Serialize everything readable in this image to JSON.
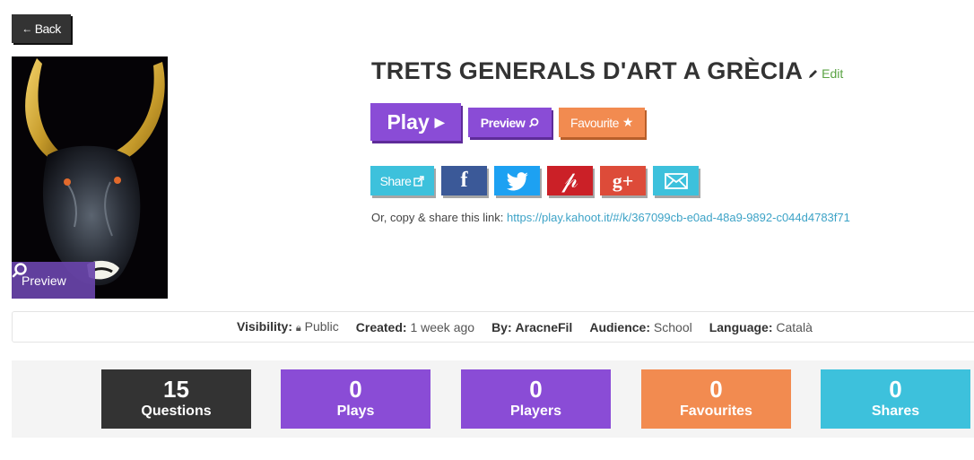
{
  "back": {
    "label": "Back"
  },
  "cover": {
    "preview_label": "Preview"
  },
  "kahoot": {
    "title": "TRETS GENERALS D'ART A GRÈCIA",
    "edit_label": "Edit"
  },
  "actions": {
    "play_label": "Play",
    "preview_label": "Preview",
    "favourite_label": "Favourite"
  },
  "share": {
    "share_label": "Share",
    "icons": [
      "external-link-icon",
      "facebook-icon",
      "twitter-icon",
      "pinterest-icon",
      "google-plus-icon",
      "mail-icon"
    ],
    "link_prefix": "Or, copy & share this link:",
    "link_url": "https://play.kahoot.it/#/k/367099cb-e0ad-48a9-9892-c044d4783f71"
  },
  "meta": {
    "visibility_label": "Visibility:",
    "visibility_value": "Public",
    "created_label": "Created:",
    "created_value": "1 week ago",
    "by_label": "By:",
    "by_value": "AracneFil",
    "audience_label": "Audience:",
    "audience_value": "School",
    "language_label": "Language:",
    "language_value": "Català"
  },
  "stats": [
    {
      "value": "15",
      "label": "Questions",
      "color": "#333333"
    },
    {
      "value": "0",
      "label": "Plays",
      "color": "#8a4cd6"
    },
    {
      "value": "0",
      "label": "Players",
      "color": "#8a4cd6"
    },
    {
      "value": "0",
      "label": "Favourites",
      "color": "#f28b50"
    },
    {
      "value": "0",
      "label": "Shares",
      "color": "#3dc1dc"
    }
  ],
  "colors": {
    "purple": "#8a4cd6",
    "orange": "#f28b50",
    "cyan": "#3dc1dc",
    "dark": "#333333",
    "edit_green": "#5aa343",
    "link_blue": "#3da3c7"
  }
}
